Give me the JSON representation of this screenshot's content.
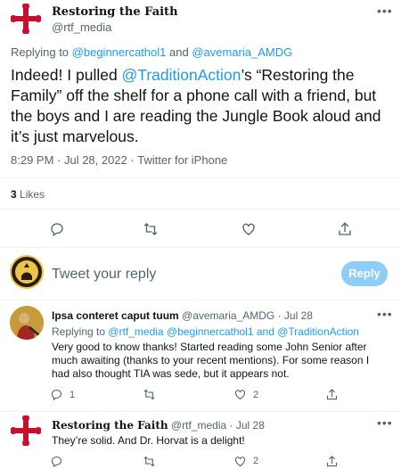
{
  "main_tweet": {
    "author_name": "Restoring the Faith",
    "author_handle": "@rtf_media",
    "replying_prefix": "Replying to",
    "reply_to_1": "@beginnercathol1",
    "reply_and": "and",
    "reply_to_2": "@avemaria_AMDG",
    "text_1": "Indeed!  I pulled ",
    "mention": "@TraditionAction",
    "text_2": "’s “Restoring the Family” off the shelf for a phone call with a friend, but the boys and I are reading the Jungle Book aloud and it’s just marvelous.",
    "timestamp": "8:29 PM · Jul 28, 2022 · Twitter for iPhone",
    "likes_count": "3",
    "likes_label": "Likes"
  },
  "compose": {
    "placeholder": "Tweet your reply",
    "button_label": "Reply"
  },
  "replies": [
    {
      "author_name": "Ipsa conteret caput tuum",
      "author_handle": "@avemaria_AMDG",
      "time": "· Jul 28",
      "replying_prefix": "Replying to",
      "reply_to": "@rtf_media @beginnercathol1 and @TraditionAction",
      "text": "Very good to know thanks! Started reading some John Senior after much awaiting (thanks to your recent mentions). For some reason I had also thought TIA was sede, but it appears not.",
      "reply_count": "1",
      "like_count": "2"
    },
    {
      "author_name": "Restoring the Faith",
      "author_handle": "@rtf_media",
      "time": "· Jul 28",
      "text": "They’re solid.  And Dr. Horvat is a delight!",
      "like_count": "2"
    }
  ],
  "colors": {
    "accent": "#1d9bf0",
    "cross_red": "#c8102e",
    "text_gray": "#536471"
  }
}
